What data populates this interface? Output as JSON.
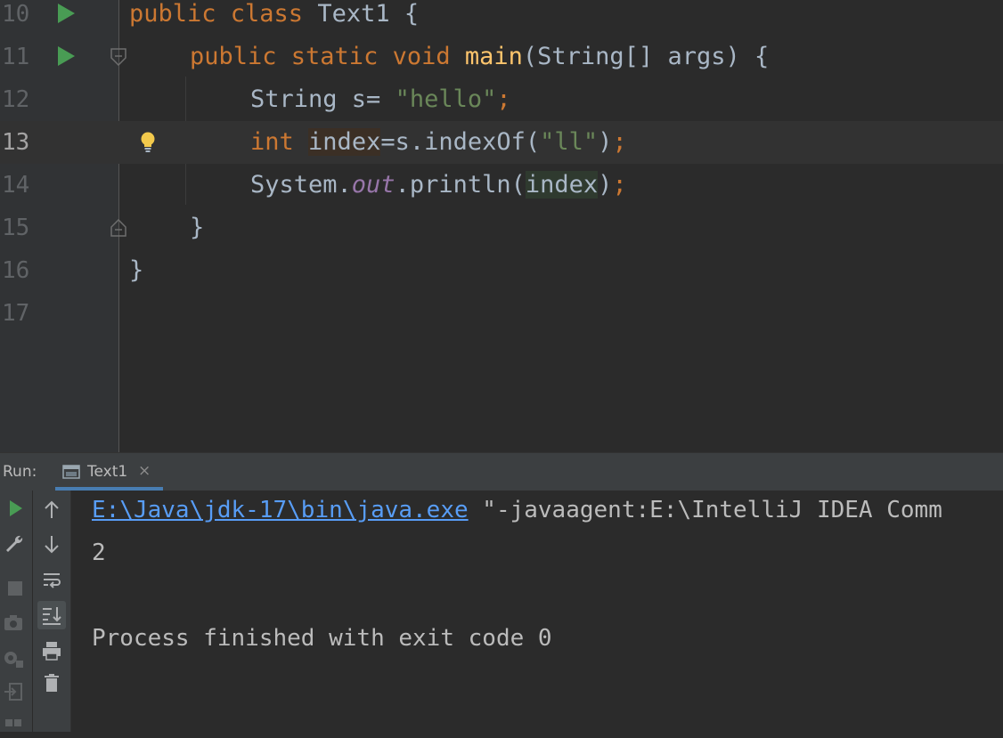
{
  "editor": {
    "lines": [
      {
        "number": "10"
      },
      {
        "number": "11"
      },
      {
        "number": "12"
      },
      {
        "number": "13"
      },
      {
        "number": "14"
      },
      {
        "number": "15"
      },
      {
        "number": "16"
      },
      {
        "number": "17"
      }
    ],
    "code": {
      "l10_kw": "public class ",
      "l10_name": "Text1 {",
      "l11_kw": "public static void ",
      "l11_fn": "main",
      "l11_rest": "(String[] args) {",
      "l12_type": "String s= ",
      "l12_str": "\"hello\"",
      "l12_semi": ";",
      "l13_kw": "int",
      "l13_sp": " ",
      "l13_var": "index",
      "l13_mid": "=s.indexOf(",
      "l13_str": "\"ll\"",
      "l13_close": ")",
      "l13_semi": ";",
      "l14_a": "System.",
      "l14_out": "out",
      "l14_b": ".println(",
      "l14_var": "index",
      "l14_close": ")",
      "l14_semi": ";",
      "l15": "}",
      "l16": "}"
    },
    "colors": {
      "keyword": "#cc7832",
      "function": "#ffc66d",
      "string": "#6a8759",
      "static_field": "#9876aa",
      "default": "#a9b7c6"
    }
  },
  "run_window": {
    "label": "Run:",
    "tab_name": "Text1",
    "tab_close": "×",
    "console": {
      "cmd_link": "E:\\Java\\jdk-17\\bin\\java.exe",
      "cmd_rest": " \"-javaagent:E:\\IntelliJ IDEA Comm",
      "output": "2",
      "exit_message": "Process finished with exit code 0"
    }
  }
}
